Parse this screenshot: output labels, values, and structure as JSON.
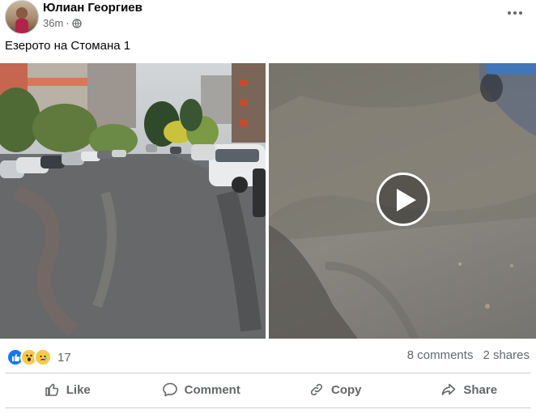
{
  "post": {
    "author": "Юлиан Георгиев",
    "time": "36m",
    "time_separator": "·",
    "audience_icon": "globe-icon",
    "caption": "Езерото на Стомана 1"
  },
  "reactions": {
    "icons": [
      "like-icon",
      "wow-icon",
      "sad-icon"
    ],
    "count": "17"
  },
  "stats": {
    "comments": "8 comments",
    "shares": "2 shares"
  },
  "actions": {
    "like": "Like",
    "comment": "Comment",
    "copy": "Copy",
    "share": "Share"
  },
  "colors": {
    "accent": "#1877f2",
    "secondary_text": "#65676b",
    "divider": "#ced0d4"
  }
}
